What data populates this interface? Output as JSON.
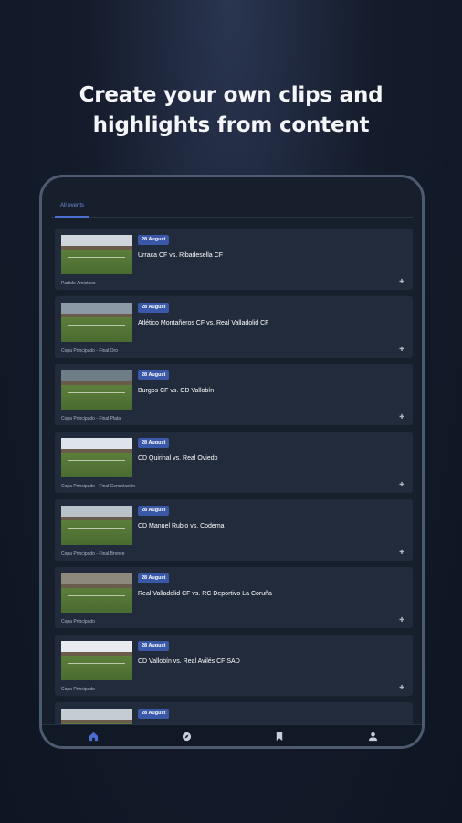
{
  "headline": {
    "line1": "Create your own clips and",
    "line2": "highlights from content"
  },
  "tabs": {
    "all_events": "All events"
  },
  "events": [
    {
      "date": "28 August",
      "title": "Urraca CF vs. Ribadesella CF",
      "competition": "Partido Amistoso"
    },
    {
      "date": "28 August",
      "title": "Atlético Montañeros CF vs. Real Valladolid CF",
      "competition": "Copa Principado - Final Oro"
    },
    {
      "date": "28 August",
      "title": "Burgos CF vs. CD Vallobín",
      "competition": "Copa Principado - Final Plata"
    },
    {
      "date": "28 August",
      "title": "CD Quirinal vs. Real Oviedo",
      "competition": "Copa Principado - Final Consolación"
    },
    {
      "date": "28 August",
      "title": "CD Manuel Rubio vs. Codema",
      "competition": "Copa Principado - Final Bronce"
    },
    {
      "date": "28 August",
      "title": "Real Valladolid CF vs. RC Deportivo La Coruña",
      "competition": "Copa Principado"
    },
    {
      "date": "28 August",
      "title": "CD Vallobín vs. Real Avilés CF SAD",
      "competition": "Copa Principado"
    },
    {
      "date": "28 August",
      "title": "",
      "competition": ""
    }
  ],
  "nav": {
    "icons": [
      "home-icon",
      "explore-icon",
      "bookmark-icon",
      "profile-icon"
    ],
    "active_color": "#4a6fd1",
    "inactive_color": "#c8cdd6"
  },
  "colors": {
    "accent": "#3a58a8",
    "background": "#141b2b",
    "card": "#222b3b"
  }
}
